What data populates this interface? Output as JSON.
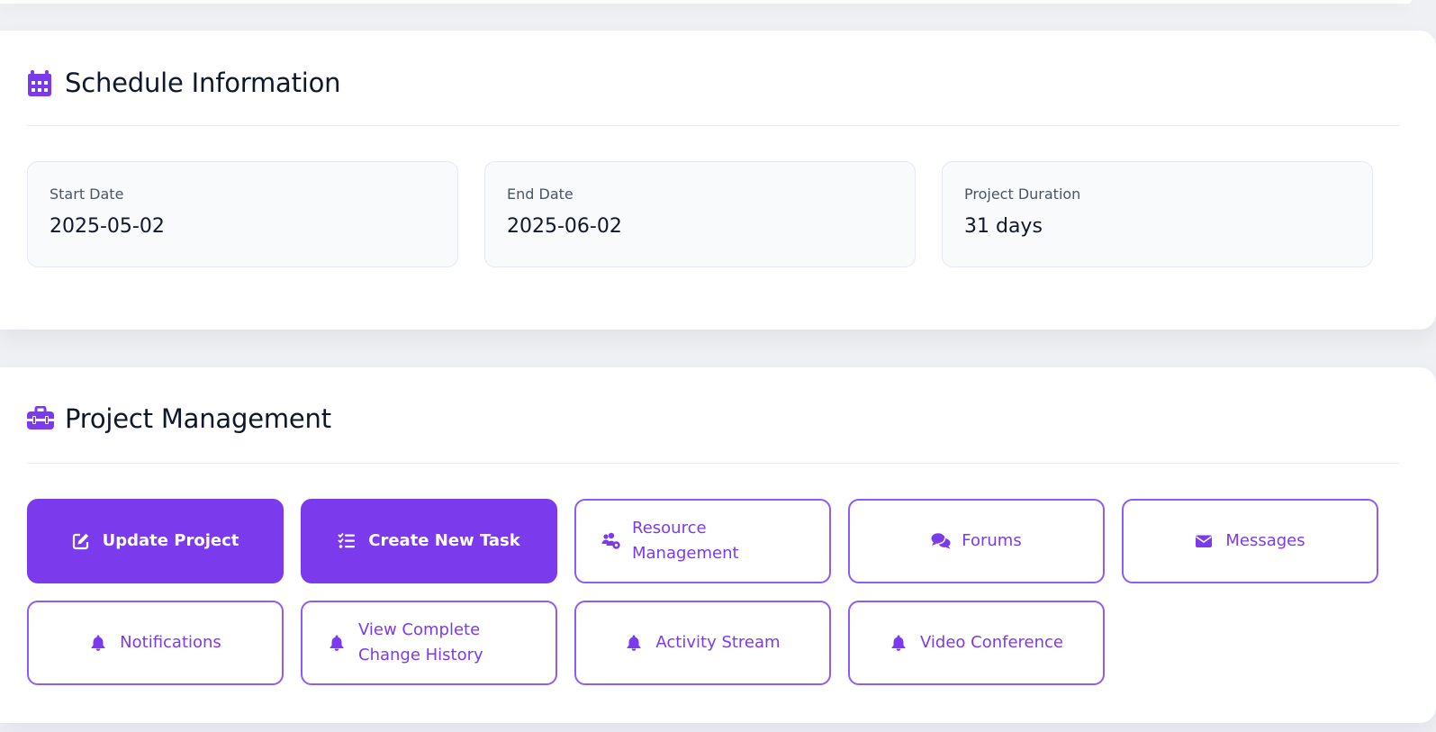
{
  "schedule": {
    "title": "Schedule Information",
    "icon": "calendar-icon",
    "fields": [
      {
        "label": "Start Date",
        "value": "2025-05-02"
      },
      {
        "label": "End Date",
        "value": "2025-06-02"
      },
      {
        "label": "Project Duration",
        "value": "31 days"
      }
    ]
  },
  "management": {
    "title": "Project Management",
    "icon": "toolbox-icon",
    "actions": [
      {
        "label": "Update Project",
        "icon": "edit-icon",
        "style": "primary"
      },
      {
        "label": "Create New Task",
        "icon": "task-list-icon",
        "style": "primary"
      },
      {
        "label": "Resource Management",
        "icon": "users-gear-icon",
        "style": "outline"
      },
      {
        "label": "Forums",
        "icon": "comments-icon",
        "style": "outline"
      },
      {
        "label": "Messages",
        "icon": "envelope-icon",
        "style": "outline"
      },
      {
        "label": "Notifications",
        "icon": "bell-icon",
        "style": "outline"
      },
      {
        "label": "View Complete Change History",
        "icon": "bell-icon",
        "style": "outline"
      },
      {
        "label": "Activity Stream",
        "icon": "bell-icon",
        "style": "outline"
      },
      {
        "label": "Video Conference",
        "icon": "bell-icon",
        "style": "outline"
      }
    ]
  },
  "colors": {
    "accent": "#7c3aed",
    "card_bg": "#ffffff",
    "field_bg": "#f8fafc",
    "page_bg": "#eef0f4",
    "text_dark": "#0f172a",
    "text_muted": "#4b5563"
  }
}
